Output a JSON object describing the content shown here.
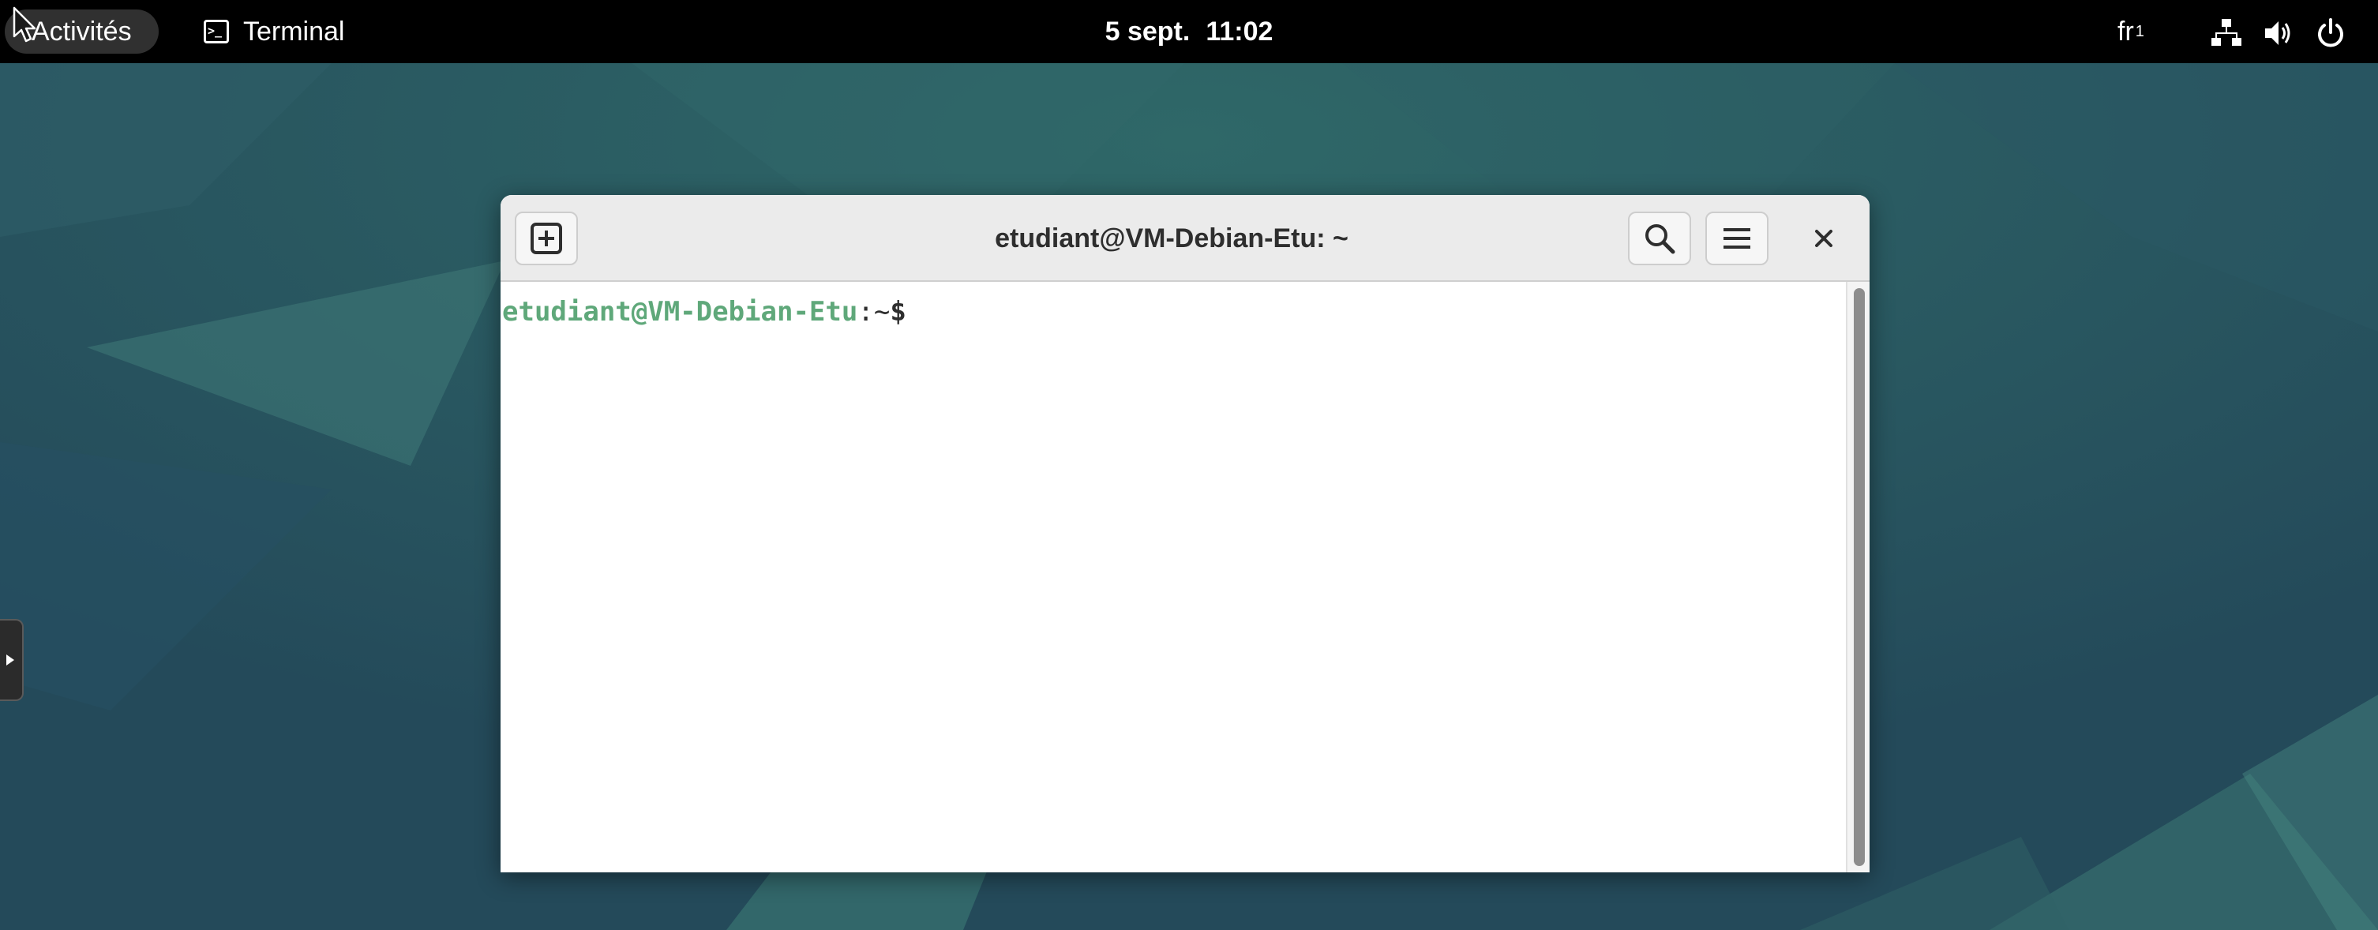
{
  "topbar": {
    "activities_label": "Activités",
    "app_name": "Terminal",
    "app_icon": "terminal-icon",
    "clock_date": "5 sept.",
    "clock_time": "11:02",
    "keyboard_layout": "fr",
    "keyboard_layout_index": "1",
    "tray_icons": [
      "network-wired-icon",
      "volume-icon",
      "power-icon"
    ]
  },
  "terminal": {
    "title": "etudiant@VM-Debian-Etu: ~",
    "prompt": {
      "user_host": "etudiant@VM-Debian-Etu",
      "separator": ":",
      "directory": "~",
      "symbol": "$"
    },
    "header_icons": [
      "new-tab-icon",
      "search-icon",
      "hamburger-menu-icon",
      "close-icon"
    ]
  },
  "dock": {
    "handle_icon": "expand-arrow-icon"
  },
  "colors": {
    "topbar_bg": "#000000",
    "wallpaper_base": "#2a5560",
    "prompt_user_host": "#5fa87a",
    "headerbar_bg": "#ebebeb",
    "terminal_bg": "#ffffff"
  }
}
